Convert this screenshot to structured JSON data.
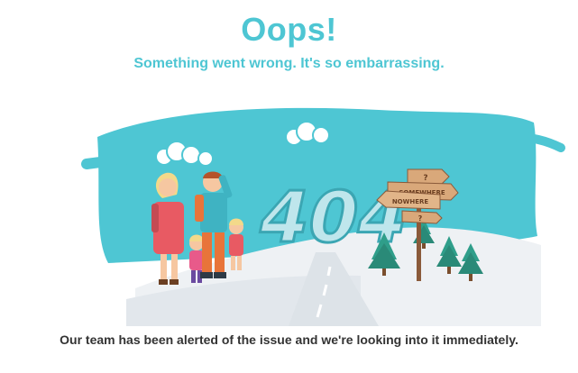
{
  "header": {
    "title": "Oops!",
    "subtitle": "Something went wrong. It's so embarrassing."
  },
  "illustration": {
    "code_text": "404",
    "signpost": {
      "top": "?",
      "middle": "SOMEWHERE",
      "lower": "NOWHERE",
      "bottom": "?"
    }
  },
  "footer": {
    "message": "Our team has been alerted of the issue and we're looking into it immediately."
  },
  "colors": {
    "accent": "#4ec6d3",
    "sky": "#4ec6d3",
    "snow": "#eef1f4",
    "text": "#333333"
  }
}
